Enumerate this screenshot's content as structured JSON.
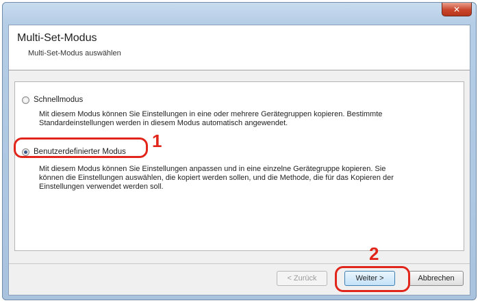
{
  "window": {
    "title": "",
    "close_glyph": "✕"
  },
  "header": {
    "title": "Multi-Set-Modus",
    "subtitle": "Multi-Set-Modus auswählen"
  },
  "options": [
    {
      "label": "Schnellmodus",
      "checked": false,
      "description_lines": [
        "Mit diesem Modus können Sie Einstellungen in eine oder mehrere Gerätegruppen kopieren. Bestimmte",
        "Standardeinstellungen werden in diesem Modus automatisch angewendet."
      ]
    },
    {
      "label": "Benutzerdefinierter Modus",
      "checked": true,
      "description_lines": [
        "Mit diesem Modus können Sie Einstellungen anpassen und in eine einzelne Gerätegruppe kopieren. Sie",
        "können die Einstellungen auswählen, die kopiert werden sollen, und die Methode, die für das Kopieren der",
        "Einstellungen verwendet werden soll."
      ]
    }
  ],
  "steps": {
    "one": "1",
    "two": "2"
  },
  "buttons": {
    "back": "< Zurück",
    "next": "Weiter >",
    "cancel": "Abbrechen"
  },
  "colors": {
    "highlight": "#e1251b",
    "titlebar": "#b5cde6"
  }
}
